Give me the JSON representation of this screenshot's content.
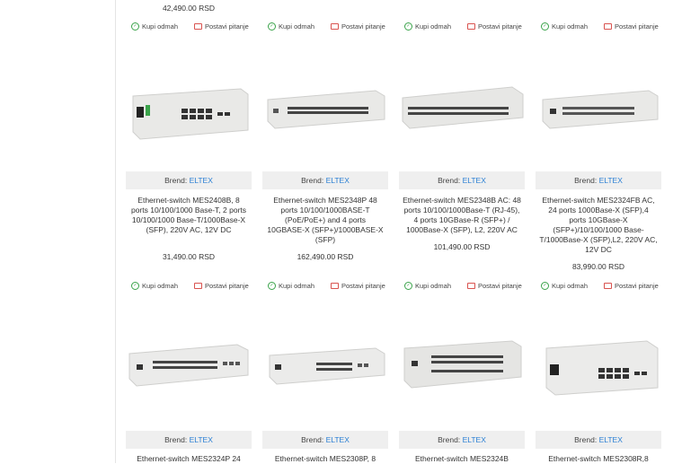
{
  "actions": {
    "buy_label": "Kupi odmah",
    "ask_label": "Postavi pitanje"
  },
  "brand_prefix": "Brend:",
  "top_row": {
    "price_0": "42,490.00 RSD"
  },
  "products": [
    {
      "brand": "ELTEX",
      "title": "Ethernet-switch MES2408B, 8 ports 10/100/1000 Base-T, 2 ports 10/100/1000 Base-T/1000Base-X (SFP), 220V AC, 12V DC",
      "price": "31,490.00 RSD",
      "image": "switch-10port-icon"
    },
    {
      "brand": "ELTEX",
      "title": "Ethernet-switch MES2348P 48 ports 10/100/1000BASE-T (PoE/PoE+) and 4 ports 10GBASE-X (SFP+)/1000BASE-X (SFP)",
      "price": "162,490.00 RSD",
      "image": "switch-48port-icon"
    },
    {
      "brand": "ELTEX",
      "title": "Ethernet-switch MES2348B AC: 48 ports 10/100/1000Base-T (RJ-45), 4 ports 10GBase-R (SFP+) / 1000Base-X (SFP), L2, 220V AC",
      "price": "101,490.00 RSD",
      "image": "switch-48port-icon"
    },
    {
      "brand": "ELTEX",
      "title": "Ethernet-switch MES2324FB AC, 24 ports 1000Base-X (SFP),4 ports 10GBase-X (SFP+)/10/100/1000 Base-T/1000Base-X (SFP),L2, 220V AC, 12V DC",
      "price": "83,990.00 RSD",
      "image": "switch-24port-icon"
    }
  ],
  "bottom_row": [
    {
      "brand": "ELTEX",
      "title": "Ethernet-switch MES2324P 24"
    },
    {
      "brand": "ELTEX",
      "title": "Ethernet-switch MES2308P, 8"
    },
    {
      "brand": "ELTEX",
      "title": "Ethernet-switch MES2324B"
    },
    {
      "brand": "ELTEX",
      "title": "Ethernet-switch MES2308R,8"
    }
  ]
}
